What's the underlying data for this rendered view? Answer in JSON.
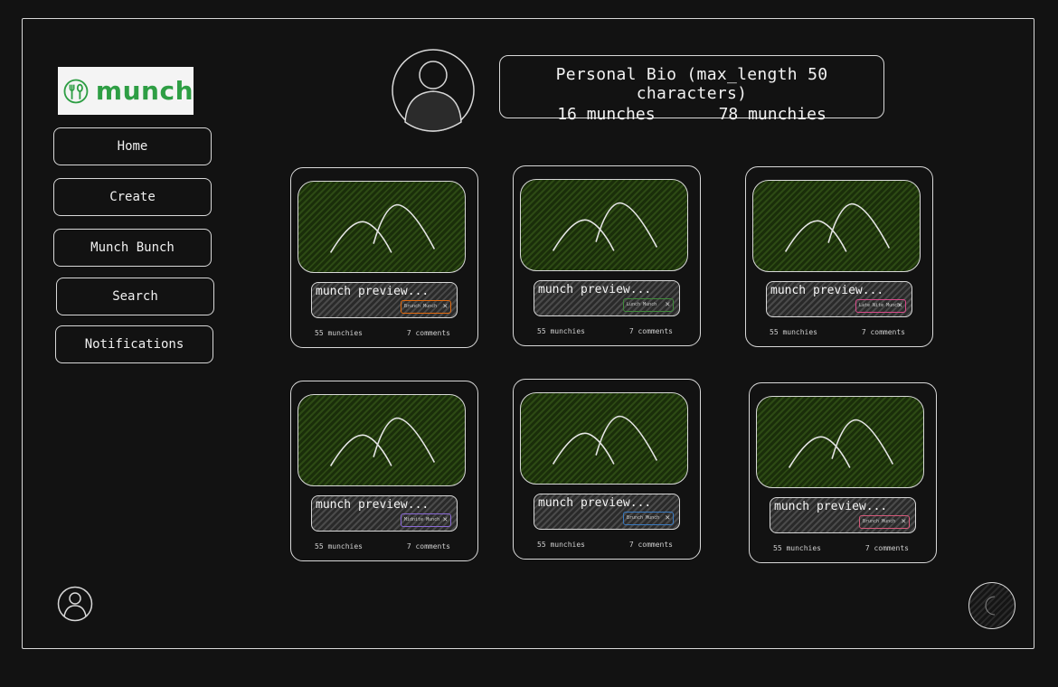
{
  "brand": {
    "name": "munch",
    "accent": "#2e9e44"
  },
  "nav": [
    {
      "label": "Home"
    },
    {
      "label": "Create"
    },
    {
      "label": "Munch Bunch"
    },
    {
      "label": "Search"
    },
    {
      "label": "Notifications"
    }
  ],
  "profile": {
    "bio": "Personal Bio (max_length 50 characters)",
    "munches": "16 munches",
    "munchies": "78 munchies"
  },
  "cards": [
    {
      "preview": "munch preview...",
      "tag": "Brunch Munch",
      "tag_color": "#e06a10",
      "munchies": "55 munchies",
      "comments": "7 comments"
    },
    {
      "preview": "munch preview...",
      "tag": "Lunch Munch",
      "tag_color": "#3f8a3a",
      "munchies": "55 munchies",
      "comments": "7 comments"
    },
    {
      "preview": "munch preview...",
      "tag": "Late Nite Munch",
      "tag_color": "#d94a8a",
      "munchies": "55 munchies",
      "comments": "7 comments"
    },
    {
      "preview": "munch preview...",
      "tag": "Midnite Munch",
      "tag_color": "#8a6ad6",
      "munchies": "55 munchies",
      "comments": "7 comments"
    },
    {
      "preview": "munch preview...",
      "tag": "Brunch Munch",
      "tag_color": "#3a7ac0",
      "munchies": "55 munchies",
      "comments": "7 comments"
    },
    {
      "preview": "munch preview...",
      "tag": "Brunch Munch",
      "tag_color": "#d65a7a",
      "munchies": "55 munchies",
      "comments": "7 comments"
    }
  ],
  "icons": {
    "logo": "fork-spoon-icon",
    "profile": "user-avatar-icon",
    "image": "mountain-image-icon",
    "close": "close-icon",
    "account": "user-icon",
    "theme": "moon-icon"
  }
}
